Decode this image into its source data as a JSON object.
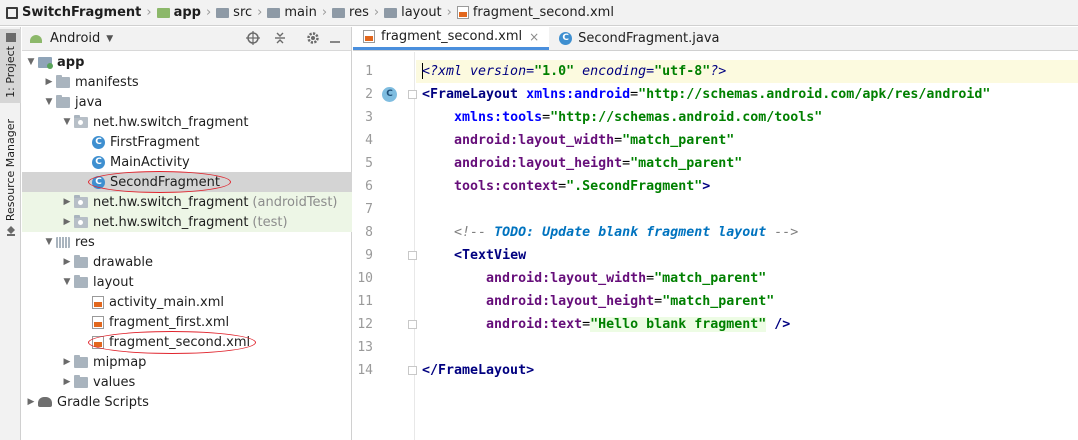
{
  "breadcrumb": {
    "items": [
      "SwitchFragment",
      "app",
      "src",
      "main",
      "res",
      "layout",
      "fragment_second.xml"
    ],
    "separator": "›"
  },
  "left_strip": {
    "project_tab": "1: Project",
    "resource_manager_tab": "Resource Manager"
  },
  "project_panel": {
    "view_selector": "Android",
    "toolbar_icons": [
      "crosshair-icon",
      "collapse-icon",
      "gear-icon",
      "hide-icon"
    ]
  },
  "tree": [
    {
      "label": "app",
      "suffix": "",
      "icon": "module-folder-icon",
      "arrow": "down",
      "depth": 0,
      "bold": true
    },
    {
      "label": "manifests",
      "suffix": "",
      "icon": "folder-icon",
      "arrow": "right",
      "depth": 1
    },
    {
      "label": "java",
      "suffix": "",
      "icon": "folder-icon",
      "arrow": "down",
      "depth": 1
    },
    {
      "label": "net.hw.switch_fragment",
      "suffix": "",
      "icon": "package-icon",
      "arrow": "down",
      "depth": 2
    },
    {
      "label": "FirstFragment",
      "suffix": "",
      "icon": "class-icon",
      "arrow": "",
      "depth": 3
    },
    {
      "label": "MainActivity",
      "suffix": "",
      "icon": "class-icon",
      "arrow": "",
      "depth": 3
    },
    {
      "label": "SecondFragment",
      "suffix": "",
      "icon": "class-icon",
      "arrow": "",
      "depth": 3,
      "selected": true,
      "circled": true
    },
    {
      "label": "net.hw.switch_fragment",
      "suffix": "(androidTest)",
      "icon": "package-icon",
      "arrow": "right",
      "depth": 2,
      "test": true
    },
    {
      "label": "net.hw.switch_fragment",
      "suffix": "(test)",
      "icon": "package-icon",
      "arrow": "right",
      "depth": 2,
      "test": true
    },
    {
      "label": "res",
      "suffix": "",
      "icon": "res-folder-icon",
      "arrow": "down",
      "depth": 1
    },
    {
      "label": "drawable",
      "suffix": "",
      "icon": "folder-icon",
      "arrow": "right",
      "depth": 2
    },
    {
      "label": "layout",
      "suffix": "",
      "icon": "folder-icon",
      "arrow": "down",
      "depth": 2
    },
    {
      "label": "activity_main.xml",
      "suffix": "",
      "icon": "xml-file-icon",
      "arrow": "",
      "depth": 3
    },
    {
      "label": "fragment_first.xml",
      "suffix": "",
      "icon": "xml-file-icon",
      "arrow": "",
      "depth": 3
    },
    {
      "label": "fragment_second.xml",
      "suffix": "",
      "icon": "xml-file-icon",
      "arrow": "",
      "depth": 3,
      "circled": true
    },
    {
      "label": "mipmap",
      "suffix": "",
      "icon": "folder-icon",
      "arrow": "right",
      "depth": 2
    },
    {
      "label": "values",
      "suffix": "",
      "icon": "folder-icon",
      "arrow": "right",
      "depth": 2
    },
    {
      "label": "Gradle Scripts",
      "suffix": "",
      "icon": "gradle-icon",
      "arrow": "right",
      "depth": 0
    }
  ],
  "editor": {
    "tabs": [
      {
        "label": "fragment_second.xml",
        "active": true,
        "icon": "xml-file-icon",
        "closable": true
      },
      {
        "label": "SecondFragment.java",
        "active": false,
        "icon": "class-icon",
        "closable": false
      }
    ],
    "current_line": 1,
    "lines": [
      {
        "n": "1",
        "tokens": [
          [
            "caret",
            ""
          ],
          [
            "pi",
            "<?xml version="
          ],
          [
            "str",
            "\"1.0\""
          ],
          [
            "pi",
            " encoding="
          ],
          [
            "str",
            "\"utf-8\""
          ],
          [
            "pi",
            "?>"
          ]
        ]
      },
      {
        "n": "2",
        "mark": "C",
        "fold": true,
        "tokens": [
          [
            "tag",
            "<FrameLayout "
          ],
          [
            "ns",
            "xmlns:android"
          ],
          [
            "plain",
            "="
          ],
          [
            "str",
            "\"http://schemas.android.com/apk/res/android\""
          ]
        ]
      },
      {
        "n": "3",
        "tokens": [
          [
            "plain",
            "    "
          ],
          [
            "ns",
            "xmlns:tools"
          ],
          [
            "plain",
            "="
          ],
          [
            "str",
            "\"http://schemas.android.com/tools\""
          ]
        ]
      },
      {
        "n": "4",
        "tokens": [
          [
            "plain",
            "    "
          ],
          [
            "attr",
            "android:layout_width"
          ],
          [
            "plain",
            "="
          ],
          [
            "str",
            "\"match_parent\""
          ]
        ]
      },
      {
        "n": "5",
        "tokens": [
          [
            "plain",
            "    "
          ],
          [
            "attr",
            "android:layout_height"
          ],
          [
            "plain",
            "="
          ],
          [
            "str",
            "\"match_parent\""
          ]
        ]
      },
      {
        "n": "6",
        "tokens": [
          [
            "plain",
            "    "
          ],
          [
            "attr",
            "tools:context"
          ],
          [
            "plain",
            "="
          ],
          [
            "str",
            "\".SecondFragment\""
          ],
          [
            "tag",
            ">"
          ]
        ]
      },
      {
        "n": "7",
        "tokens": []
      },
      {
        "n": "8",
        "tokens": [
          [
            "plain",
            "    "
          ],
          [
            "comment",
            "<!-- "
          ],
          [
            "todo",
            "TODO: Update blank fragment layout"
          ],
          [
            "comment",
            " -->"
          ]
        ]
      },
      {
        "n": "9",
        "fold": true,
        "tokens": [
          [
            "plain",
            "    "
          ],
          [
            "tag",
            "<TextView"
          ]
        ]
      },
      {
        "n": "10",
        "tokens": [
          [
            "plain",
            "        "
          ],
          [
            "attr",
            "android:layout_width"
          ],
          [
            "plain",
            "="
          ],
          [
            "str",
            "\"match_parent\""
          ]
        ]
      },
      {
        "n": "11",
        "tokens": [
          [
            "plain",
            "        "
          ],
          [
            "attr",
            "android:layout_height"
          ],
          [
            "plain",
            "="
          ],
          [
            "str",
            "\"match_parent\""
          ]
        ]
      },
      {
        "n": "12",
        "fold": true,
        "tokens": [
          [
            "plain",
            "        "
          ],
          [
            "attr",
            "android:text"
          ],
          [
            "plain",
            "="
          ],
          [
            "hlstr",
            "\"Hello blank fragment\""
          ],
          [
            "tag",
            " />"
          ]
        ]
      },
      {
        "n": "13",
        "tokens": []
      },
      {
        "n": "14",
        "fold": true,
        "tokens": [
          [
            "tag",
            "</FrameLayout>"
          ]
        ]
      }
    ]
  },
  "colors": {
    "selection": "#d4d4d4",
    "test_row": "#edf6e6",
    "current_line": "#fcfadf",
    "annotation_circle": "#e0242d",
    "tab_underline": "#4a8fdd"
  }
}
